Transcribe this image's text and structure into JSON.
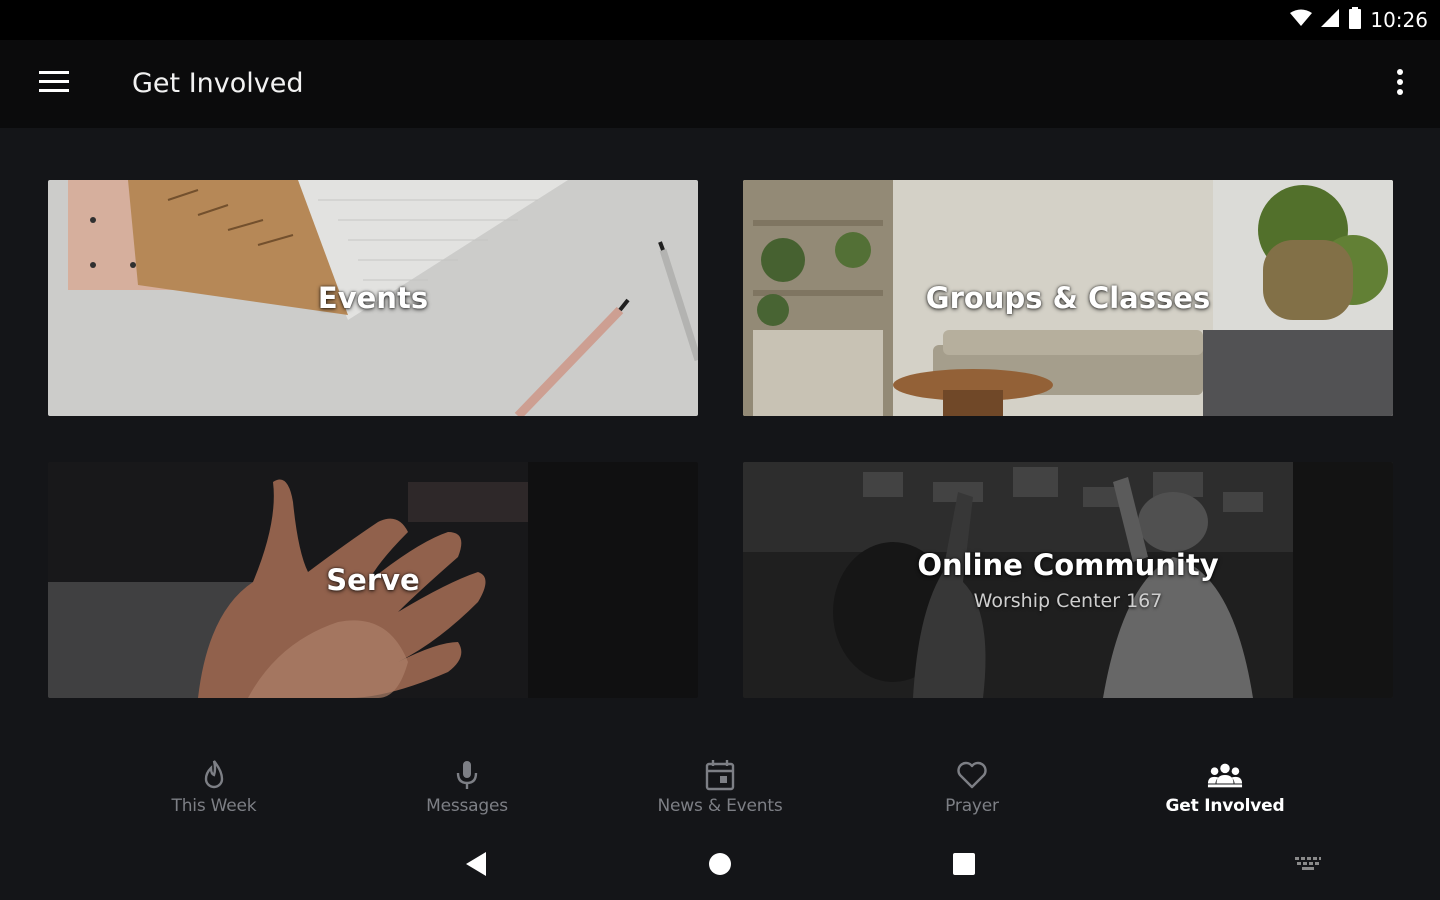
{
  "status_bar": {
    "time": "10:26",
    "icons": [
      "wifi-icon",
      "signal-icon",
      "battery-icon"
    ]
  },
  "app_bar": {
    "title": "Get Involved",
    "menu_icon": "hamburger-menu-icon",
    "overflow_icon": "more-vertical-icon"
  },
  "cards": [
    {
      "title": "Events",
      "subtitle": ""
    },
    {
      "title": "Groups & Classes",
      "subtitle": ""
    },
    {
      "title": "Serve",
      "subtitle": ""
    },
    {
      "title": "Online Community",
      "subtitle": "Worship Center 167"
    }
  ],
  "bottom_nav": {
    "items": [
      {
        "label": "This Week",
        "icon": "flame-icon",
        "active": false
      },
      {
        "label": "Messages",
        "icon": "microphone-icon",
        "active": false
      },
      {
        "label": "News & Events",
        "icon": "calendar-icon",
        "active": false
      },
      {
        "label": "Prayer",
        "icon": "heart-icon",
        "active": false
      },
      {
        "label": "Get Involved",
        "icon": "people-group-icon",
        "active": true
      }
    ]
  },
  "system_nav": {
    "buttons": [
      "back-icon",
      "home-icon",
      "recents-icon",
      "keyboard-icon"
    ]
  },
  "colors": {
    "background": "#141518",
    "app_bar": "#0b0b0c",
    "nav_inactive": "#7d7f85",
    "nav_active": "#ffffff"
  }
}
